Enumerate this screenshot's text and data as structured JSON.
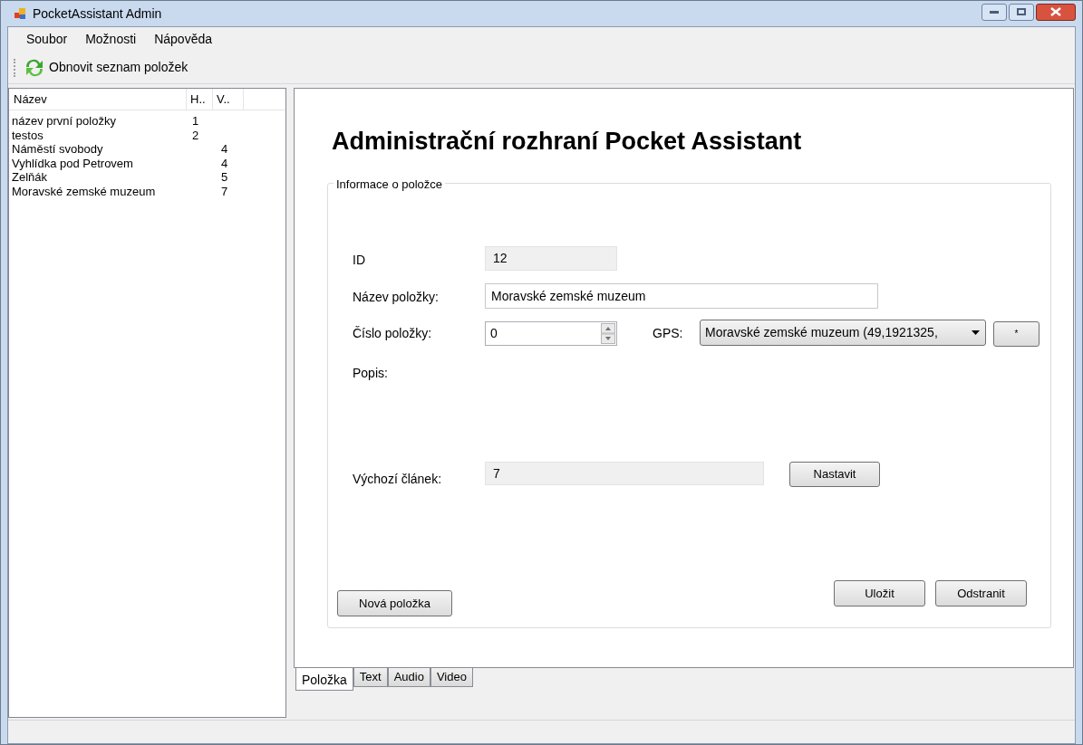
{
  "window": {
    "title": "PocketAssistant Admin"
  },
  "menu": [
    "Soubor",
    "Možnosti",
    "Nápověda"
  ],
  "toolbar": {
    "refresh_button": "Obnovit seznam položek"
  },
  "list": {
    "columns": [
      "Název",
      "H..",
      "V.."
    ],
    "rows": [
      {
        "cells": [
          "název první položky",
          "1",
          ""
        ],
        "selected": false
      },
      {
        "cells": [
          "testos",
          "2",
          ""
        ],
        "selected": false
      },
      {
        "cells": [
          "Náměstí svobody",
          "",
          "4"
        ],
        "selected": false
      },
      {
        "cells": [
          "Vyhlídka pod Petrovem",
          "",
          "4"
        ],
        "selected": false
      },
      {
        "cells": [
          "Zelňák",
          "",
          "5"
        ],
        "selected": false
      },
      {
        "cells": [
          "Moravské zemské muzeum",
          "",
          "7"
        ],
        "selected": false
      }
    ]
  },
  "heading": "Administrační rozhraní Pocket Assistant",
  "group": {
    "title": "Informace o položce",
    "id": {
      "label": "ID",
      "value": "12"
    },
    "name": {
      "label": "Název položky:",
      "value": "Moravské zemské muzeum"
    },
    "number": {
      "label": "Číslo položky:",
      "value": "0"
    },
    "gps": {
      "label": "GPS:",
      "value": "Moravské zemské muzeum (49,1921325,",
      "button": "*"
    },
    "description": {
      "label": "Popis:"
    },
    "article": {
      "label": "Výchozí článek:",
      "value": "7",
      "button": "Nastavit"
    },
    "new_button": "Nová položka",
    "save_button": "Uložit",
    "delete_button": "Odstranit"
  },
  "tabs": [
    {
      "label": "Položka",
      "selected": true
    },
    {
      "label": "Text",
      "selected": false
    },
    {
      "label": "Audio",
      "selected": false
    },
    {
      "label": "Video",
      "selected": false
    }
  ]
}
